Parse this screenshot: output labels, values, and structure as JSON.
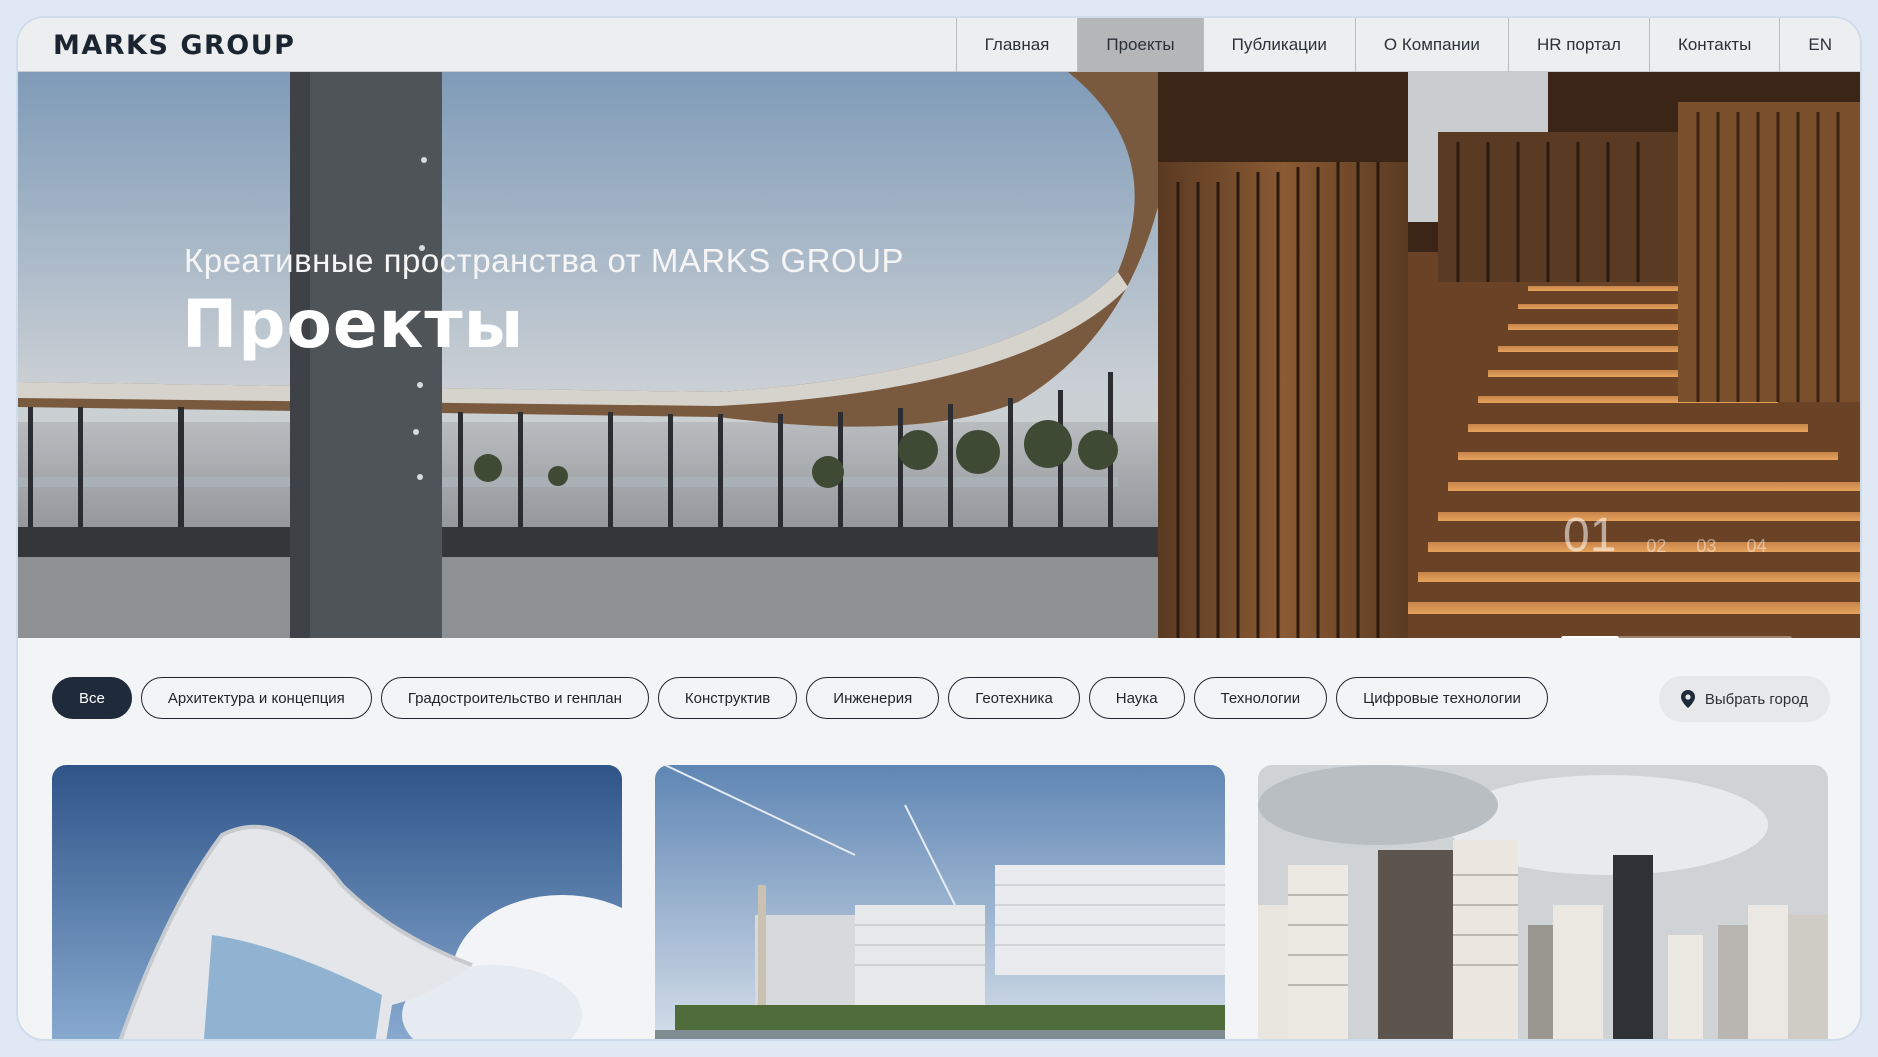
{
  "header": {
    "logo": "MARKS GROUP",
    "nav": [
      {
        "label": "Главная"
      },
      {
        "label": "Проекты",
        "active": true
      },
      {
        "label": "Публикации"
      },
      {
        "label": "О Компании"
      },
      {
        "label": "HR портал"
      },
      {
        "label": "Контакты"
      },
      {
        "label": "EN"
      }
    ]
  },
  "hero": {
    "subtitle": "Креативные пространства от MARKS GROUP",
    "title": "Проекты",
    "slider": {
      "current": "01",
      "others": [
        "02",
        "03",
        "04"
      ],
      "progress": 0.25
    }
  },
  "filters": {
    "chips": [
      {
        "label": "Все",
        "active": true
      },
      {
        "label": "Архитектура и концепция"
      },
      {
        "label": "Градостроительство и генплан"
      },
      {
        "label": "Конструктив"
      },
      {
        "label": "Инженерия"
      },
      {
        "label": "Геотехника"
      },
      {
        "label": "Наука"
      },
      {
        "label": "Технологии"
      },
      {
        "label": "Цифровые технологии"
      }
    ],
    "city_button": "Выбрать город",
    "city_icon": "map-pin-icon"
  },
  "colors": {
    "accent_dark": "#1f2b3a",
    "active_nav": "#b4b6b8",
    "page_bg": "#f3f4f6"
  }
}
